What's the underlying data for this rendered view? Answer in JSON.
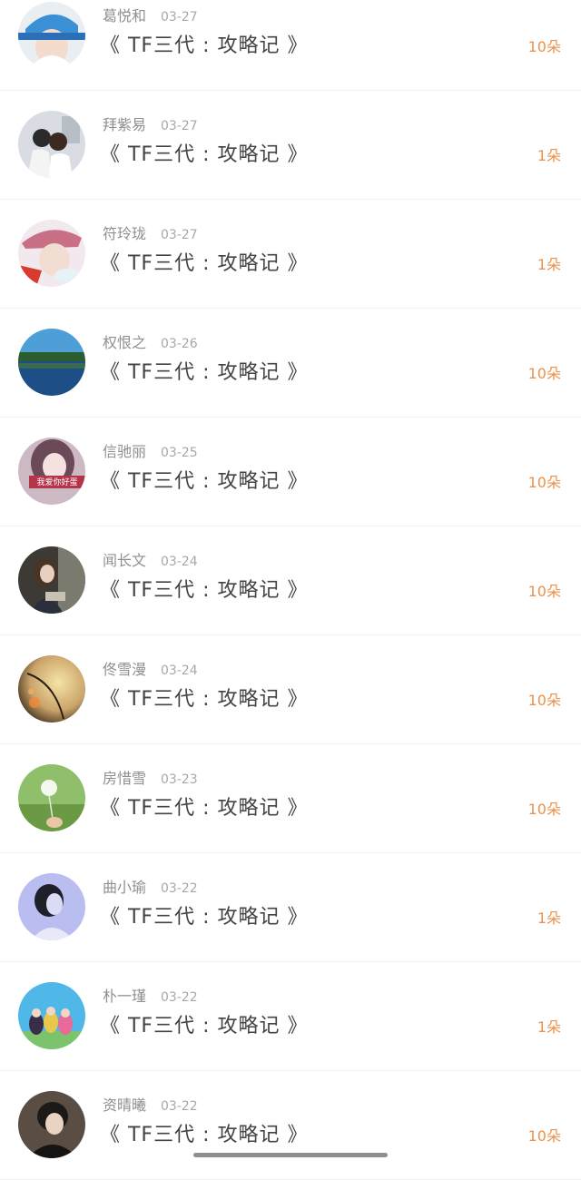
{
  "colors": {
    "count": "#e9914f",
    "name": "#8f8f8f",
    "title": "#444444"
  },
  "items": [
    {
      "name": "葛悦和",
      "date": "03-27",
      "title": "《 TF三代 : 攻略记 》",
      "count": "10朵",
      "avatar": "avatar-girl-cap"
    },
    {
      "name": "拜紫易",
      "date": "03-27",
      "title": "《 TF三代 : 攻略记 》",
      "count": "1朵",
      "avatar": "avatar-couple"
    },
    {
      "name": "符玲珑",
      "date": "03-27",
      "title": "《 TF三代 : 攻略记 》",
      "count": "1朵",
      "avatar": "avatar-boy-hat"
    },
    {
      "name": "权恨之",
      "date": "03-26",
      "title": "《 TF三代 : 攻略记 》",
      "count": "10朵",
      "avatar": "avatar-lake"
    },
    {
      "name": "信驰丽",
      "date": "03-25",
      "title": "《 TF三代 : 攻略记 》",
      "count": "10朵",
      "avatar": "avatar-girl-text",
      "avatar_caption": "我爱你好蛋"
    },
    {
      "name": "闻长文",
      "date": "03-24",
      "title": "《 TF三代 : 攻略记 》",
      "count": "10朵",
      "avatar": "avatar-reading-girl"
    },
    {
      "name": "佟雪漫",
      "date": "03-24",
      "title": "《 TF三代 : 攻略记 》",
      "count": "10朵",
      "avatar": "avatar-bokeh"
    },
    {
      "name": "房惜雪",
      "date": "03-23",
      "title": "《 TF三代 : 攻略记 》",
      "count": "10朵",
      "avatar": "avatar-dandelion"
    },
    {
      "name": "曲小瑜",
      "date": "03-22",
      "title": "《 TF三代 : 攻略记 》",
      "count": "1朵",
      "avatar": "avatar-sketch-girl"
    },
    {
      "name": "朴一瑾",
      "date": "03-22",
      "title": "《 TF三代 : 攻略记 》",
      "count": "1朵",
      "avatar": "avatar-cartoon"
    },
    {
      "name": "资晴曦",
      "date": "03-22",
      "title": "《 TF三代 : 攻略记 》",
      "count": "10朵",
      "avatar": "avatar-dark-boy"
    }
  ]
}
